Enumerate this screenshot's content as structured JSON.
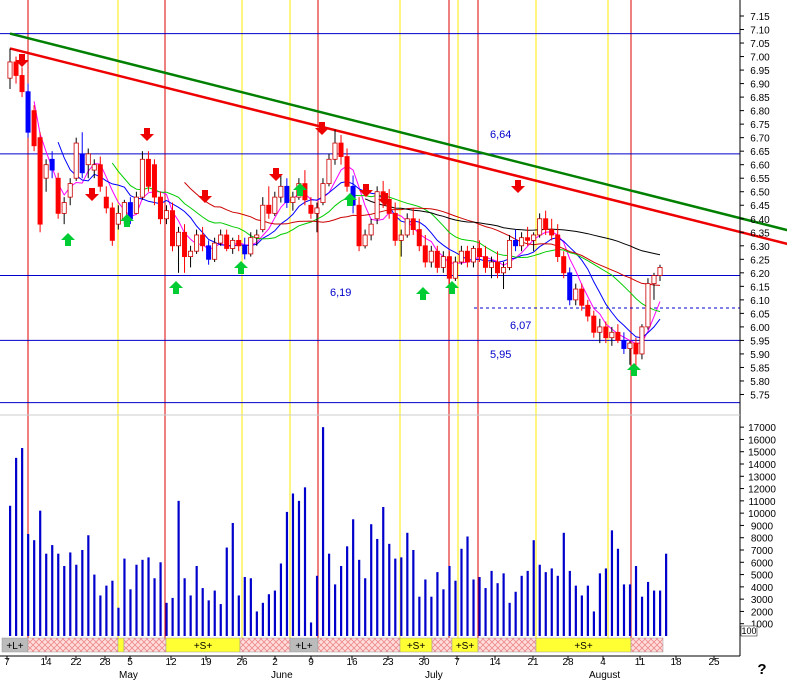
{
  "chart_data": {
    "type": "candlestick",
    "title": "",
    "colors": {
      "up_candle": "#ffffff",
      "down_candle": "#ff0000",
      "blue_candle": "#0000ff",
      "volume": "#0000cc",
      "trend_green": "#008000",
      "trend_red": "#ee0000",
      "ma_black": "#000000",
      "ma_green": "#00cc00",
      "ma_red": "#cc0000",
      "ma_blue": "#0000ff",
      "ma_magenta": "#ff00ff",
      "arrow_up": "#00cc33",
      "arrow_down": "#ee0000",
      "cycle_line_red": "#dd0000",
      "cycle_line_yellow": "#ffee00",
      "signal_yellow": "#ffff33",
      "signal_grey": "#bbbbbb"
    },
    "price_axis": {
      "min": 5.7,
      "max": 7.15,
      "ticks": [
        "7.15",
        "7.10",
        "7.05",
        "7.00",
        "6.95",
        "6.90",
        "6.85",
        "6.80",
        "6.75",
        "6.70",
        "6.65",
        "6.60",
        "6.55",
        "6.50",
        "6.45",
        "6.40",
        "6.35",
        "6.30",
        "6.25",
        "6.20",
        "6.15",
        "6.10",
        "6.05",
        "6.00",
        "5.95",
        "5.90",
        "5.85",
        "5.80",
        "5.75"
      ]
    },
    "volume_axis": {
      "min": 0,
      "max": 17500,
      "ticks": [
        "17000",
        "16000",
        "15000",
        "14000",
        "13000",
        "12000",
        "11000",
        "10000",
        "9000",
        "8000",
        "7000",
        "6000",
        "5000",
        "4000",
        "3000",
        "2000",
        "1000"
      ],
      "unit_label": "100"
    },
    "x_axis": {
      "day_labels": [
        "7",
        "14",
        "22",
        "28",
        "5",
        "12",
        "19",
        "26",
        "2",
        "9",
        "16",
        "23",
        "30",
        "7",
        "14",
        "21",
        "28",
        "4",
        "11",
        "18",
        "25"
      ],
      "month_labels": [
        "May",
        "June",
        "July",
        "August"
      ],
      "corner_label": "?"
    },
    "price_levels": [
      {
        "value": 7.085,
        "label": ""
      },
      {
        "value": 6.64,
        "label": "6,64"
      },
      {
        "value": 6.19,
        "label": "6,19"
      },
      {
        "value": 6.07,
        "label": "6,07",
        "dashed": true
      },
      {
        "value": 5.95,
        "label": "5,95"
      },
      {
        "value": 5.72,
        "label": ""
      }
    ],
    "trend_lines": [
      {
        "name": "",
        "color": "green",
        "from": [
          0,
          7.085
        ],
        "to": [
          159,
          6.19
        ]
      },
      {
        "name": "",
        "color": "red",
        "from": [
          0,
          7.03
        ],
        "to": [
          159,
          6.14
        ]
      }
    ],
    "candles": [
      [
        6.92,
        7.03,
        6.88,
        6.98
      ],
      [
        6.98,
        7.0,
        6.9,
        6.93
      ],
      [
        6.93,
        6.96,
        6.85,
        6.87
      ],
      [
        6.87,
        6.9,
        6.7,
        6.72
      ],
      [
        6.8,
        6.82,
        6.65,
        6.67
      ],
      [
        6.7,
        6.72,
        6.35,
        6.38
      ],
      [
        6.55,
        6.62,
        6.5,
        6.6
      ],
      [
        6.62,
        6.65,
        6.55,
        6.58
      ],
      [
        6.55,
        6.57,
        6.4,
        6.42
      ],
      [
        6.42,
        6.48,
        6.38,
        6.46
      ],
      [
        6.48,
        6.55,
        6.45,
        6.53
      ],
      [
        6.55,
        6.7,
        6.54,
        6.68
      ],
      [
        6.64,
        6.72,
        6.55,
        6.57
      ],
      [
        6.6,
        6.66,
        6.55,
        6.64
      ],
      [
        6.58,
        6.62,
        6.55,
        6.6
      ],
      [
        6.6,
        6.63,
        6.5,
        6.52
      ],
      [
        6.48,
        6.52,
        6.42,
        6.44
      ],
      [
        6.44,
        6.46,
        6.3,
        6.32
      ],
      [
        6.38,
        6.45,
        6.36,
        6.42
      ],
      [
        6.4,
        6.47,
        6.38,
        6.46
      ],
      [
        6.46,
        6.48,
        6.38,
        6.4
      ],
      [
        6.42,
        6.5,
        6.42,
        6.48
      ],
      [
        6.48,
        6.65,
        6.47,
        6.62
      ],
      [
        6.62,
        6.65,
        6.5,
        6.52
      ],
      [
        6.6,
        6.62,
        6.45,
        6.48
      ],
      [
        6.48,
        6.5,
        6.38,
        6.4
      ],
      [
        6.4,
        6.45,
        6.38,
        6.43
      ],
      [
        6.43,
        6.46,
        6.28,
        6.3
      ],
      [
        6.3,
        6.37,
        6.2,
        6.35
      ],
      [
        6.35,
        6.38,
        6.2,
        6.26
      ],
      [
        6.26,
        6.3,
        6.22,
        6.28
      ],
      [
        6.28,
        6.36,
        6.27,
        6.34
      ],
      [
        6.34,
        6.37,
        6.28,
        6.3
      ],
      [
        6.3,
        6.32,
        6.23,
        6.25
      ],
      [
        6.25,
        6.33,
        6.24,
        6.31
      ],
      [
        6.31,
        6.36,
        6.3,
        6.34
      ],
      [
        6.34,
        6.36,
        6.28,
        6.29
      ],
      [
        6.29,
        6.33,
        6.27,
        6.32
      ],
      [
        6.32,
        6.34,
        6.28,
        6.3
      ],
      [
        6.3,
        6.33,
        6.25,
        6.27
      ],
      [
        6.27,
        6.35,
        6.26,
        6.33
      ],
      [
        6.33,
        6.36,
        6.3,
        6.34
      ],
      [
        6.36,
        6.48,
        6.35,
        6.45
      ],
      [
        6.45,
        6.52,
        6.4,
        6.42
      ],
      [
        6.42,
        6.5,
        6.41,
        6.48
      ],
      [
        6.48,
        6.56,
        6.46,
        6.52
      ],
      [
        6.52,
        6.55,
        6.44,
        6.46
      ],
      [
        6.46,
        6.5,
        6.43,
        6.48
      ],
      [
        6.48,
        6.55,
        6.47,
        6.53
      ],
      [
        6.53,
        6.58,
        6.45,
        6.47
      ],
      [
        6.45,
        6.48,
        6.4,
        6.42
      ],
      [
        6.42,
        6.46,
        6.35,
        6.44
      ],
      [
        6.46,
        6.55,
        6.45,
        6.53
      ],
      [
        6.53,
        6.64,
        6.52,
        6.62
      ],
      [
        6.62,
        6.73,
        6.6,
        6.68
      ],
      [
        6.68,
        6.71,
        6.6,
        6.63
      ],
      [
        6.63,
        6.66,
        6.5,
        6.52
      ],
      [
        6.52,
        6.56,
        6.42,
        6.45
      ],
      [
        6.45,
        6.48,
        6.28,
        6.3
      ],
      [
        6.3,
        6.36,
        6.29,
        6.34
      ],
      [
        6.34,
        6.4,
        6.32,
        6.38
      ],
      [
        6.4,
        6.52,
        6.38,
        6.5
      ],
      [
        6.5,
        6.54,
        6.44,
        6.47
      ],
      [
        6.47,
        6.51,
        6.4,
        6.42
      ],
      [
        6.42,
        6.46,
        6.3,
        6.32
      ],
      [
        6.32,
        6.36,
        6.26,
        6.34
      ],
      [
        6.34,
        6.42,
        6.33,
        6.4
      ],
      [
        6.4,
        6.44,
        6.34,
        6.36
      ],
      [
        6.36,
        6.4,
        6.28,
        6.3
      ],
      [
        6.3,
        6.34,
        6.22,
        6.24
      ],
      [
        6.24,
        6.3,
        6.22,
        6.28
      ],
      [
        6.28,
        6.3,
        6.2,
        6.22
      ],
      [
        6.22,
        6.28,
        6.2,
        6.26
      ],
      [
        6.26,
        6.28,
        6.16,
        6.18
      ],
      [
        6.18,
        6.26,
        6.17,
        6.24
      ],
      [
        6.24,
        6.3,
        6.23,
        6.28
      ],
      [
        6.28,
        6.3,
        6.22,
        6.24
      ],
      [
        6.24,
        6.3,
        6.22,
        6.29
      ],
      [
        6.29,
        6.32,
        6.24,
        6.26
      ],
      [
        6.26,
        6.3,
        6.2,
        6.22
      ],
      [
        6.22,
        6.26,
        6.18,
        6.24
      ],
      [
        6.24,
        6.28,
        6.18,
        6.2
      ],
      [
        6.2,
        6.24,
        6.14,
        6.22
      ],
      [
        6.22,
        6.34,
        6.21,
        6.32
      ],
      [
        6.32,
        6.36,
        6.28,
        6.3
      ],
      [
        6.3,
        6.35,
        6.28,
        6.33
      ],
      [
        6.33,
        6.37,
        6.3,
        6.32
      ],
      [
        6.32,
        6.35,
        6.28,
        6.34
      ],
      [
        6.34,
        6.42,
        6.33,
        6.4
      ],
      [
        6.4,
        6.43,
        6.34,
        6.36
      ],
      [
        6.36,
        6.4,
        6.32,
        6.34
      ],
      [
        6.34,
        6.38,
        6.24,
        6.26
      ],
      [
        6.26,
        6.28,
        6.18,
        6.2
      ],
      [
        6.2,
        6.22,
        6.08,
        6.1
      ],
      [
        6.1,
        6.16,
        6.08,
        6.14
      ],
      [
        6.14,
        6.16,
        6.06,
        6.08
      ],
      [
        6.08,
        6.1,
        6.02,
        6.04
      ],
      [
        6.04,
        6.06,
        5.96,
        5.98
      ],
      [
        5.98,
        6.03,
        5.94,
        6.0
      ],
      [
        6.0,
        6.02,
        5.94,
        5.96
      ],
      [
        5.96,
        6.0,
        5.93,
        5.98
      ],
      [
        5.98,
        6.01,
        5.94,
        5.95
      ],
      [
        5.95,
        5.98,
        5.9,
        5.92
      ],
      [
        5.92,
        5.95,
        5.86,
        5.94
      ],
      [
        5.94,
        5.96,
        5.82,
        5.9
      ],
      [
        5.9,
        6.01,
        5.88,
        6.0
      ],
      [
        6.0,
        6.18,
        5.99,
        6.16
      ],
      [
        6.16,
        6.2,
        6.1,
        6.19
      ],
      [
        6.19,
        6.23,
        6.17,
        6.22
      ]
    ],
    "volumes": [
      10600,
      14500,
      15300,
      8300,
      7800,
      10200,
      6700,
      7400,
      6700,
      5700,
      6800,
      5800,
      7000,
      8200,
      5000,
      3300,
      4100,
      4500,
      2300,
      6300,
      3800,
      5800,
      6200,
      6400,
      4700,
      6000,
      2700,
      3100,
      11000,
      4700,
      3300,
      5700,
      3900,
      2900,
      3700,
      2600,
      7200,
      9200,
      3300,
      4800,
      4700,
      2000,
      2700,
      3400,
      3700,
      5900,
      10100,
      11600,
      11000,
      12100,
      1100,
      4900,
      17000,
      6700,
      4200,
      5700,
      7300,
      9500,
      6200,
      4700,
      9100,
      7900,
      10500,
      7500,
      6300,
      6400,
      8400,
      7000,
      3200,
      4600,
      3200,
      5200,
      3800,
      5700,
      4500,
      7100,
      8100,
      4600,
      4800,
      3900,
      5300,
      4300,
      5100,
      2700,
      3600,
      4900,
      5300,
      7800,
      5800,
      5200,
      5500,
      4900,
      8400,
      5300,
      4100,
      3300,
      4100,
      2000,
      5100,
      5500,
      8600,
      7100,
      4200,
      4200,
      5700,
      3200,
      4400,
      3700,
      3700,
      6700
    ]
  }
}
